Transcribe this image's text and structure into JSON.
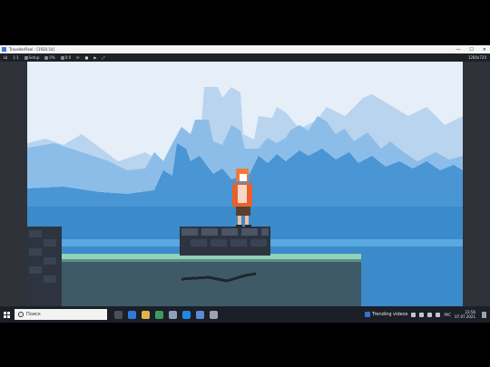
{
  "window": {
    "title": "TravellerPixel - [1920.54]"
  },
  "window_controls": {
    "minimize": "—",
    "maximize": "☐",
    "close": "✕"
  },
  "toolbar": {
    "items": [
      {
        "label": "Ш"
      },
      {
        "label": "1:1"
      },
      {
        "label": "Setup"
      },
      {
        "label": "0%"
      },
      {
        "label": "0:0"
      },
      {
        "label": "⟳"
      },
      {
        "label": "■"
      },
      {
        "label": "▶"
      },
      {
        "label": "⤢"
      }
    ],
    "right_label": "1280x720"
  },
  "scene": {
    "sky_color": "#e6eef8",
    "far_city_color": "#b9d4ef",
    "mid_city_color": "#8cbde8",
    "near_city_color": "#4a95d4",
    "water_color": "#3b8ac9",
    "ground_color": "#3e5a66",
    "grass_color": "#8fd3b8",
    "stone_color": "#2d3440"
  },
  "taskbar": {
    "search_placeholder": "Поиск",
    "trending": "Trending videos",
    "language": "РУС",
    "time": "23:56",
    "date": "07.07.2021"
  }
}
